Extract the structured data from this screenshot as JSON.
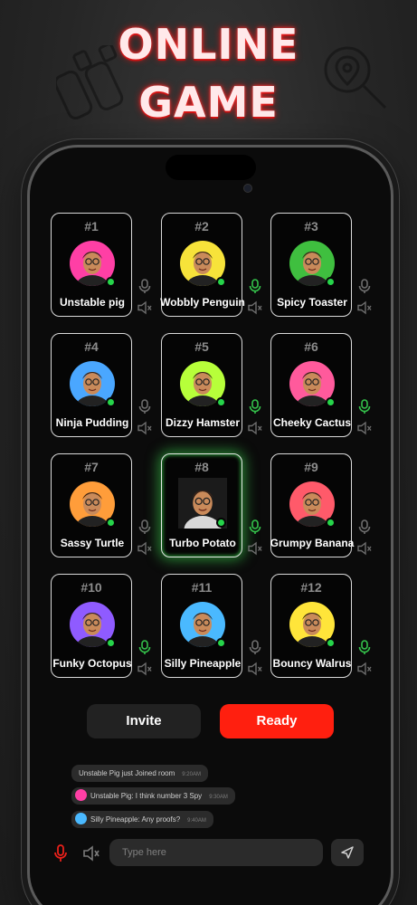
{
  "promo": {
    "line1": "ONLINE",
    "line2": "GAME"
  },
  "accent_colors": {
    "ready": "#ff1f0f",
    "online": "#26d44a",
    "mic_active": "#34c24b"
  },
  "players": [
    {
      "num": "#1",
      "name": "Unstable pig",
      "mic_active": false,
      "avatar_bg": "#ff3fa5"
    },
    {
      "num": "#2",
      "name": "Wobbly Penguin",
      "mic_active": true,
      "avatar_bg": "#f7e33a"
    },
    {
      "num": "#3",
      "name": "Spicy Toaster",
      "mic_active": false,
      "avatar_bg": "#3fbf3f"
    },
    {
      "num": "#4",
      "name": "Ninja Pudding",
      "mic_active": false,
      "avatar_bg": "#4aa7ff"
    },
    {
      "num": "#5",
      "name": "Dizzy Hamster",
      "mic_active": true,
      "avatar_bg": "#b7ff3a"
    },
    {
      "num": "#6",
      "name": "Cheeky Cactus",
      "mic_active": true,
      "avatar_bg": "#ff5a9c"
    },
    {
      "num": "#7",
      "name": "Sassy Turtle",
      "mic_active": false,
      "avatar_bg": "#ff9d3a"
    },
    {
      "num": "#8",
      "name": "Turbo Potato",
      "mic_active": true,
      "avatar_bg": "#1b1b1b"
    },
    {
      "num": "#9",
      "name": "Grumpy Banana",
      "mic_active": false,
      "avatar_bg": "#ff5a6a"
    },
    {
      "num": "#10",
      "name": "Funky Octopus",
      "mic_active": true,
      "avatar_bg": "#8f5bff"
    },
    {
      "num": "#11",
      "name": "Silly Pineapple",
      "mic_active": false,
      "avatar_bg": "#4ab9ff"
    },
    {
      "num": "#12",
      "name": "Bouncy Walrus",
      "mic_active": true,
      "avatar_bg": "#ffe53a"
    }
  ],
  "actions": {
    "invite": "Invite",
    "ready": "Ready"
  },
  "chat": {
    "messages": [
      {
        "text": "Unstable Pig just Joined room",
        "time": "9:20AM"
      },
      {
        "text": "Unstable Pig: I think number 3 Spy",
        "time": "9:30AM"
      },
      {
        "text": "Silly Pineapple: Any proofs?",
        "time": "9:40AM"
      }
    ],
    "input_placeholder": "Type here"
  }
}
